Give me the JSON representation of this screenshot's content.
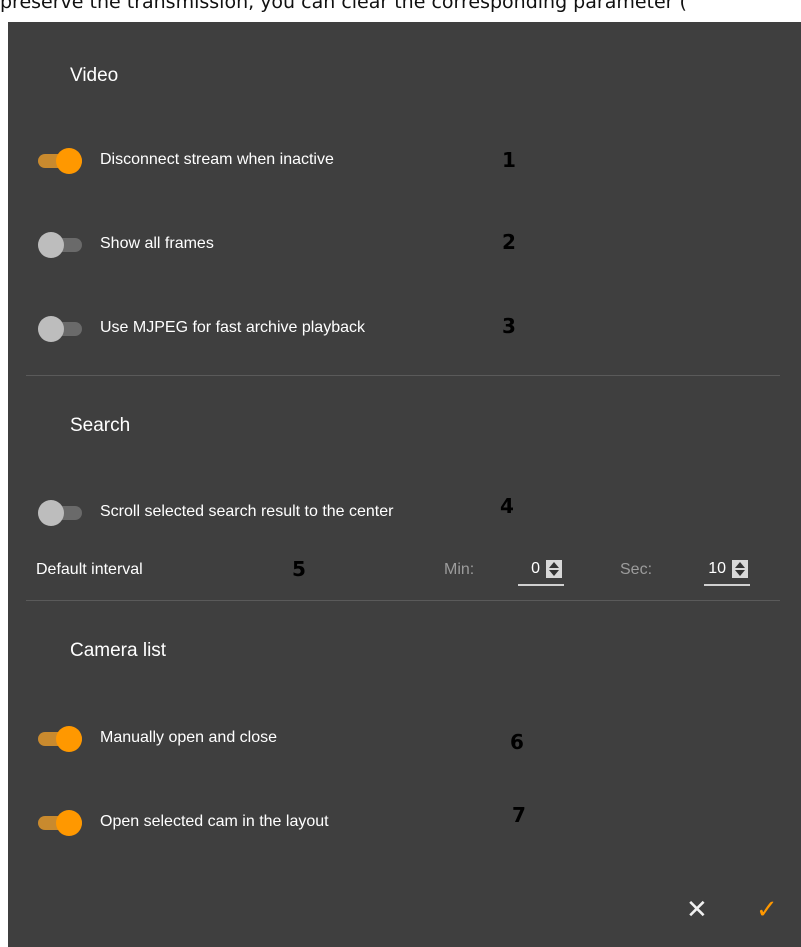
{
  "caption": "preserve the transmission, you can clear the corresponding parameter (",
  "video": {
    "title": "Video",
    "items": [
      {
        "label": "Disconnect stream when inactive",
        "on": true,
        "marker": "1"
      },
      {
        "label": "Show all frames",
        "on": false,
        "marker": "2"
      },
      {
        "label": "Use MJPEG for fast archive playback",
        "on": false,
        "marker": "3"
      }
    ]
  },
  "search": {
    "title": "Search",
    "items": [
      {
        "label": "Scroll selected search result to the center",
        "on": false,
        "marker": "4"
      }
    ],
    "interval": {
      "label": "Default interval",
      "marker": "5",
      "min_label": "Min:",
      "min_value": "0",
      "sec_label": "Sec:",
      "sec_value": "10"
    }
  },
  "camera_list": {
    "title": "Camera list",
    "items": [
      {
        "label": "Manually open and close",
        "on": true,
        "marker": "6"
      },
      {
        "label": "Open selected cam in the layout",
        "on": true,
        "marker": "7"
      }
    ]
  },
  "actions": {
    "cancel": "✕",
    "confirm": "✓"
  },
  "colors": {
    "panel": "#3f3f3f",
    "accent": "#ff9800"
  }
}
